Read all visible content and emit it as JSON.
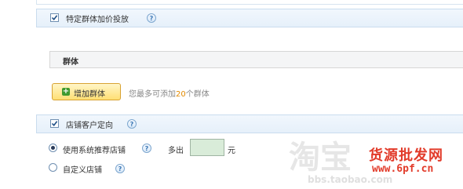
{
  "bid_section": {
    "checked": true,
    "label": "特定群体加价投放",
    "help_icon": "question-icon"
  },
  "group_table": {
    "header": "群体"
  },
  "add_group": {
    "button_label": "增加群体",
    "hint_prefix": "您最多可添加",
    "hint_count": "20",
    "hint_suffix": "个群体"
  },
  "store_section": {
    "checked": true,
    "label": "店铺客户定向",
    "help_icon": "question-icon"
  },
  "store_options": {
    "system_label": "使用系统推荐店铺",
    "system_selected": true,
    "more_label": "多出",
    "more_value": "",
    "unit": "元",
    "custom_label": "自定义店铺",
    "custom_selected": false
  },
  "watermark": {
    "brand_cn": "淘宝",
    "brand_url": "bbs.taobao.com",
    "site_cn": "货源批发网",
    "site_url": "www.6pf.cn"
  },
  "colors": {
    "accent_orange": "#e28a00",
    "input_green": "#d9ecd9",
    "section_blue": "#e6f0fa"
  }
}
